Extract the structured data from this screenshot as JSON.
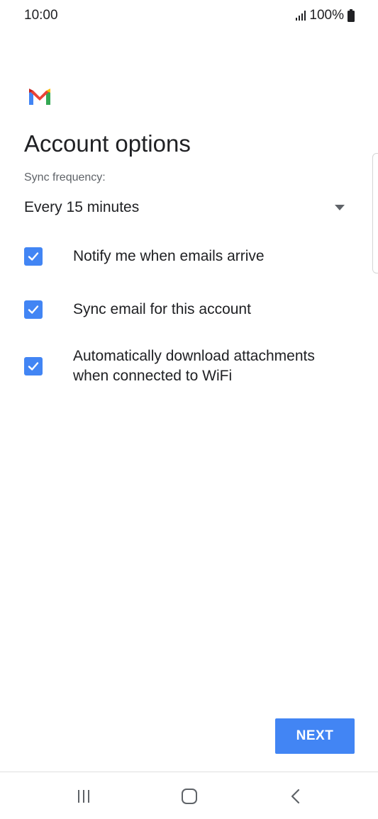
{
  "status_bar": {
    "time": "10:00",
    "battery_text": "100%",
    "icons": [
      "signal-icon",
      "battery-icon"
    ]
  },
  "app": {
    "logo": "gmail-logo-icon",
    "colors": {
      "accent": "#4285f4",
      "logo_red": "#ea4335",
      "logo_blue": "#4285f4",
      "logo_green": "#34a853",
      "logo_yellow": "#fbbc04"
    }
  },
  "page": {
    "title": "Account options"
  },
  "sync": {
    "label": "Sync frequency:",
    "selected": "Every 15 minutes"
  },
  "options": [
    {
      "label": "Notify me when emails arrive",
      "checked": true
    },
    {
      "label": "Sync email for this account",
      "checked": true
    },
    {
      "label": "Automatically download attachments when connected to WiFi",
      "checked": true
    }
  ],
  "actions": {
    "next_label": "NEXT"
  },
  "nav_bar": {
    "buttons": [
      "recent-apps-icon",
      "home-icon",
      "back-icon"
    ]
  }
}
